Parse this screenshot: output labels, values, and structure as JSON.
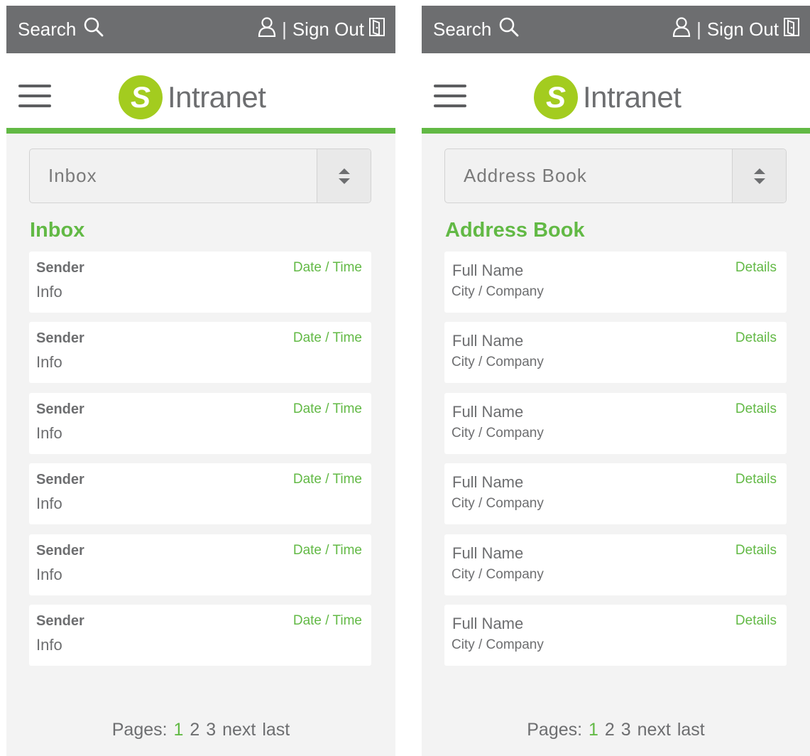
{
  "colors": {
    "accent": "#62b945",
    "topbar": "#6d6e70",
    "text": "#6d6e70",
    "logo_circle": "#a3cc1f"
  },
  "screens": [
    {
      "topbar": {
        "search_label": "Search",
        "separator": "|",
        "signout_label": "Sign Out"
      },
      "logo": {
        "letter": "S",
        "text": "Intranet"
      },
      "select": {
        "value": "Inbox"
      },
      "section_title": "Inbox",
      "items": [
        {
          "primary": "Sender",
          "secondary": "Info",
          "meta": "Date / Time"
        },
        {
          "primary": "Sender",
          "secondary": "Info",
          "meta": "Date / Time"
        },
        {
          "primary": "Sender",
          "secondary": "Info",
          "meta": "Date / Time"
        },
        {
          "primary": "Sender",
          "secondary": "Info",
          "meta": "Date / Time"
        },
        {
          "primary": "Sender",
          "secondary": "Info",
          "meta": "Date / Time"
        },
        {
          "primary": "Sender",
          "secondary": "Info",
          "meta": "Date / Time"
        }
      ],
      "pager": {
        "label": "Pages:",
        "pages": [
          "1",
          "2",
          "3"
        ],
        "current": "1",
        "next": "next",
        "last": "last"
      }
    },
    {
      "topbar": {
        "search_label": "Search",
        "separator": "|",
        "signout_label": "Sign Out"
      },
      "logo": {
        "letter": "S",
        "text": "Intranet"
      },
      "select": {
        "value": "Address Book"
      },
      "section_title": "Address Book",
      "items": [
        {
          "primary": "Full Name",
          "secondary": "City / Company",
          "meta": "Details"
        },
        {
          "primary": "Full Name",
          "secondary": "City / Company",
          "meta": "Details"
        },
        {
          "primary": "Full Name",
          "secondary": "City / Company",
          "meta": "Details"
        },
        {
          "primary": "Full Name",
          "secondary": "City / Company",
          "meta": "Details"
        },
        {
          "primary": "Full Name",
          "secondary": "City / Company",
          "meta": "Details"
        },
        {
          "primary": "Full Name",
          "secondary": "City / Company",
          "meta": "Details"
        }
      ],
      "pager": {
        "label": "Pages:",
        "pages": [
          "1",
          "2",
          "3"
        ],
        "current": "1",
        "next": "next",
        "last": "last"
      }
    }
  ]
}
